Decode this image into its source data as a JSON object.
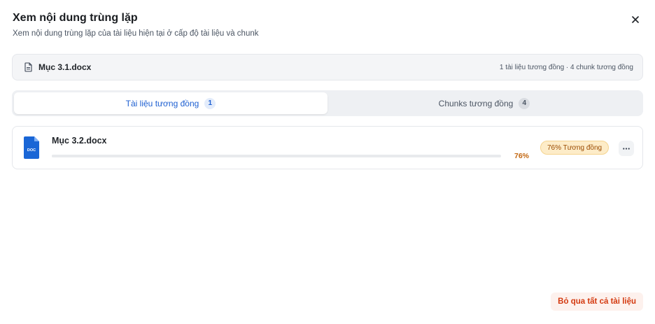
{
  "dialog": {
    "title": "Xem nội dung trùng lặp",
    "subtitle": "Xem nội dung trùng lặp của tài liệu hiện tại ở cấp độ tài liệu và chunk",
    "close_icon": "close-icon"
  },
  "source": {
    "icon": "document-icon",
    "name": "Mục 3.1.docx",
    "summary": "1 tài liệu tương đồng · 4 chunk tương đồng"
  },
  "tabs": [
    {
      "label": "Tài liệu tương đồng",
      "count": "1",
      "active": true
    },
    {
      "label": "Chunks tương đồng",
      "count": "4",
      "active": false
    }
  ],
  "results": [
    {
      "icon": "doc-file-icon",
      "icon_text": "DOC",
      "name": "Mục 3.2.docx",
      "similarity": 0.76,
      "percent": "76%",
      "badge": "76% Tương đồng",
      "menu_icon": "more-icon"
    }
  ],
  "footer": {
    "skip_all_label": "Bỏ qua tất cả tài liệu"
  },
  "colors": {
    "accent": "#1d5fd1",
    "warning": "#c2660f",
    "badge_bg": "#fdecc8",
    "danger": "#d43a10"
  }
}
